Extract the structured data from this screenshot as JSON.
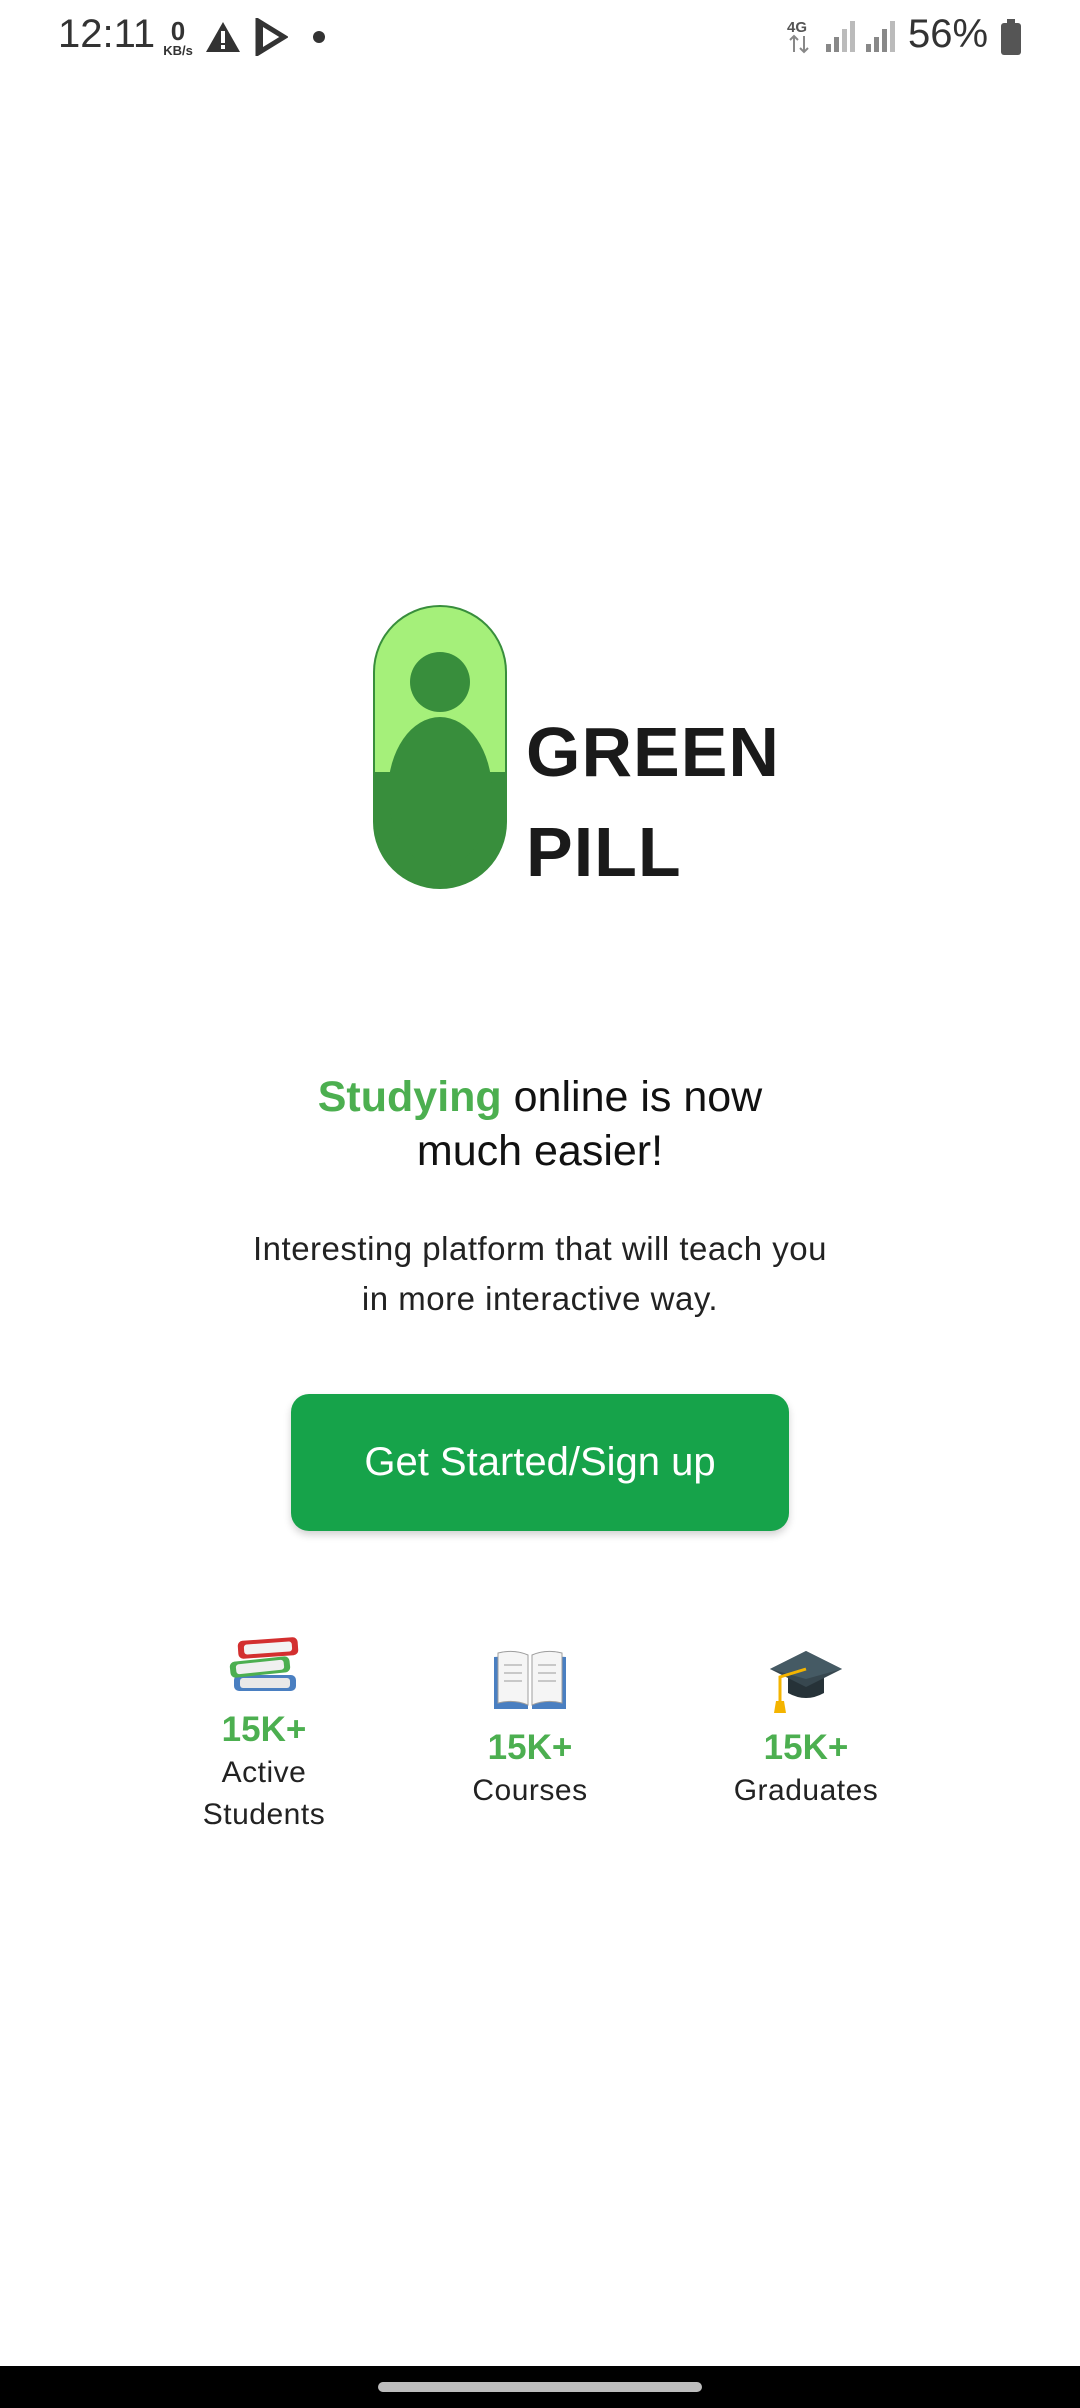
{
  "status_bar": {
    "time": "12:11",
    "net_speed_value": "0",
    "net_speed_unit": "KB/s",
    "network_type": "4G",
    "battery": "56%",
    "icons": [
      "alert-icon",
      "play-store-icon",
      "dot-icon",
      "data-arrows-icon",
      "signal-icon",
      "signal-icon",
      "battery-icon"
    ]
  },
  "logo": {
    "line1": "GREEN",
    "line2": "PILL",
    "colors": {
      "dark_green": "#388e3c",
      "light_green": "#a5f07a"
    }
  },
  "headline": {
    "accent": "Studying",
    "rest_line1": " online is now",
    "line2": "much easier!"
  },
  "subtext": {
    "line1": "Interesting platform that will teach you",
    "line2": "in more interactive way."
  },
  "cta": {
    "label": "Get Started/Sign up",
    "color": "#16a34a"
  },
  "stats": [
    {
      "icon": "books-icon",
      "value": "15K+",
      "label_line1": "Active",
      "label_line2": "Students"
    },
    {
      "icon": "open-book-icon",
      "value": "15K+",
      "label_line1": "Courses"
    },
    {
      "icon": "graduation-cap-icon",
      "value": "15K+",
      "label_line1": "Graduates"
    }
  ]
}
